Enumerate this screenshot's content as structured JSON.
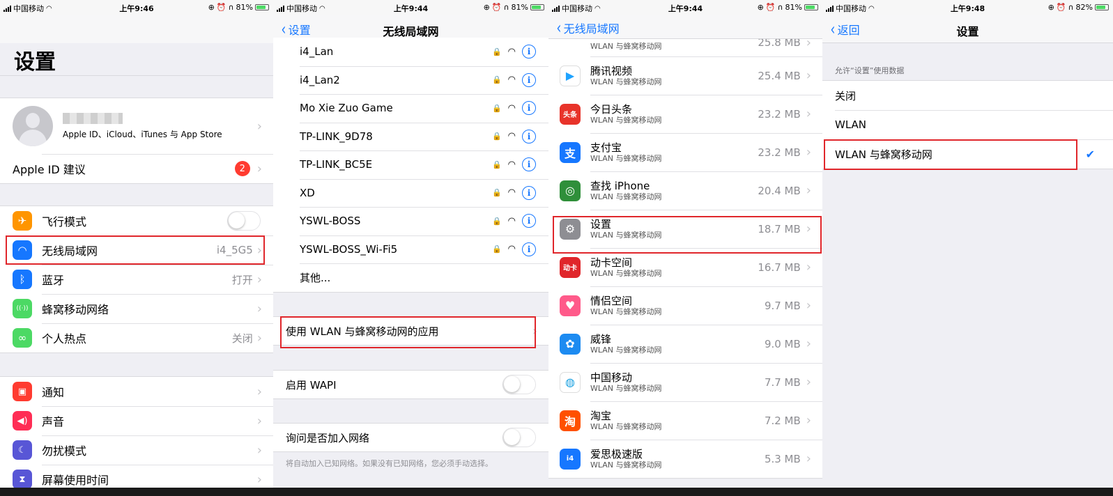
{
  "status": [
    {
      "carrier": "中国移动",
      "time": "上午9:46",
      "battery": "81%",
      "battery_level": 0.81
    },
    {
      "carrier": "中国移动",
      "time": "上午9:44",
      "battery": "81%",
      "battery_level": 0.81
    },
    {
      "carrier": "中国移动",
      "time": "上午9:44",
      "battery": "81%",
      "battery_level": 0.81
    },
    {
      "carrier": "中国移动",
      "time": "上午9:48",
      "battery": "82%",
      "battery_level": 0.82
    }
  ],
  "settings": {
    "title": "设置",
    "profile_sub": "Apple ID、iCloud、iTunes 与 App Store",
    "appleid_suggest": "Apple ID 建议",
    "appleid_badge": "2",
    "rows1": [
      {
        "label": "飞行模式",
        "value": "",
        "icon": "airplane-icon",
        "color": "#ff9500",
        "toggle": true
      },
      {
        "label": "无线局域网",
        "value": "i4_5G5",
        "icon": "wifi-icon",
        "color": "#1677ff",
        "toggle": false
      },
      {
        "label": "蓝牙",
        "value": "打开",
        "icon": "bluetooth-icon",
        "color": "#1677ff",
        "toggle": false
      },
      {
        "label": "蜂窝移动网络",
        "value": "",
        "icon": "cellular-icon",
        "color": "#4cd964",
        "toggle": false
      },
      {
        "label": "个人热点",
        "value": "关闭",
        "icon": "hotspot-icon",
        "color": "#4cd964",
        "toggle": false
      }
    ],
    "rows2": [
      {
        "label": "通知",
        "icon": "notification-icon",
        "color": "#ff3b30"
      },
      {
        "label": "声音",
        "icon": "sound-icon",
        "color": "#ff2d55"
      },
      {
        "label": "勿扰模式",
        "icon": "moon-icon",
        "color": "#5856d6"
      },
      {
        "label": "屏幕使用时间",
        "icon": "hourglass-icon",
        "color": "#5856d6"
      }
    ]
  },
  "wlan": {
    "back": "设置",
    "title": "无线局域网",
    "networks": [
      "i4_Lan",
      "i4_Lan2",
      "Mo Xie Zuo Game",
      "TP-LINK_9D78",
      "TP-LINK_BC5E",
      "XD",
      "YSWL-BOSS",
      "YSWL-BOSS_Wi-Fi5"
    ],
    "other": "其他...",
    "apps_using": "使用 WLAN 与蜂窝移动网的应用",
    "wapi": "启用 WAPI",
    "ask_join": "询问是否加入网络",
    "footnote": "将自动加入已知网络。如果没有已知网络，您必须手动选择。"
  },
  "apps": {
    "back": "无线局域网",
    "partial": {
      "sub": "WLAN 与蜂窝移动网",
      "size": "25.8 MB"
    },
    "list": [
      {
        "name": "腾讯视频",
        "sub": "WLAN 与蜂窝移动网",
        "size": "25.4 MB",
        "icon": "tencent-video-icon",
        "color": "#ffffff",
        "glyph": "▶",
        "fg": "#1fa3ff"
      },
      {
        "name": "今日头条",
        "sub": "WLAN 与蜂窝移动网",
        "size": "23.2 MB",
        "icon": "toutiao-icon",
        "color": "#e8332a",
        "glyph": "头条",
        "fg": "#ffffff"
      },
      {
        "name": "支付宝",
        "sub": "WLAN 与蜂窝移动网",
        "size": "23.2 MB",
        "icon": "alipay-icon",
        "color": "#1677ff",
        "glyph": "支",
        "fg": "#ffffff"
      },
      {
        "name": "查找 iPhone",
        "sub": "WLAN 与蜂窝移动网",
        "size": "20.4 MB",
        "icon": "find-iphone-icon",
        "color": "#2f8f3a",
        "glyph": "◎",
        "fg": "#ffffff"
      },
      {
        "name": "设置",
        "sub": "WLAN 与蜂窝移动网",
        "size": "18.7 MB",
        "icon": "settings-gear-icon",
        "color": "#8e8e93",
        "glyph": "⚙",
        "fg": "#ffffff"
      },
      {
        "name": "动卡空间",
        "sub": "WLAN 与蜂窝移动网",
        "size": "16.7 MB",
        "icon": "dongka-icon",
        "color": "#e0262b",
        "glyph": "动卡",
        "fg": "#ffffff"
      },
      {
        "name": "情侣空间",
        "sub": "WLAN 与蜂窝移动网",
        "size": "9.7 MB",
        "icon": "couple-icon",
        "color": "#ff5a8a",
        "glyph": "♥",
        "fg": "#ffffff"
      },
      {
        "name": "威锋",
        "sub": "WLAN 与蜂窝移动网",
        "size": "9.0 MB",
        "icon": "weifeng-icon",
        "color": "#1d8bf1",
        "glyph": "✿",
        "fg": "#ffffff"
      },
      {
        "name": "中国移动",
        "sub": "WLAN 与蜂窝移动网",
        "size": "7.7 MB",
        "icon": "china-mobile-icon",
        "color": "#ffffff",
        "glyph": "◍",
        "fg": "#1aa1e1"
      },
      {
        "name": "淘宝",
        "sub": "WLAN 与蜂窝移动网",
        "size": "7.2 MB",
        "icon": "taobao-icon",
        "color": "#ff5000",
        "glyph": "淘",
        "fg": "#ffffff"
      },
      {
        "name": "爱思极速版",
        "sub": "WLAN 与蜂窝移动网",
        "size": "5.3 MB",
        "icon": "i4-icon",
        "color": "#1677ff",
        "glyph": "i4",
        "fg": "#ffffff"
      }
    ]
  },
  "data_settings": {
    "back": "返回",
    "title": "设置",
    "header": "允许“设置”使用数据",
    "options": [
      "关闭",
      "WLAN",
      "WLAN 与蜂窝移动网"
    ],
    "selected_index": 2
  },
  "accent": "#1677ff",
  "highlight": "#e0262b"
}
